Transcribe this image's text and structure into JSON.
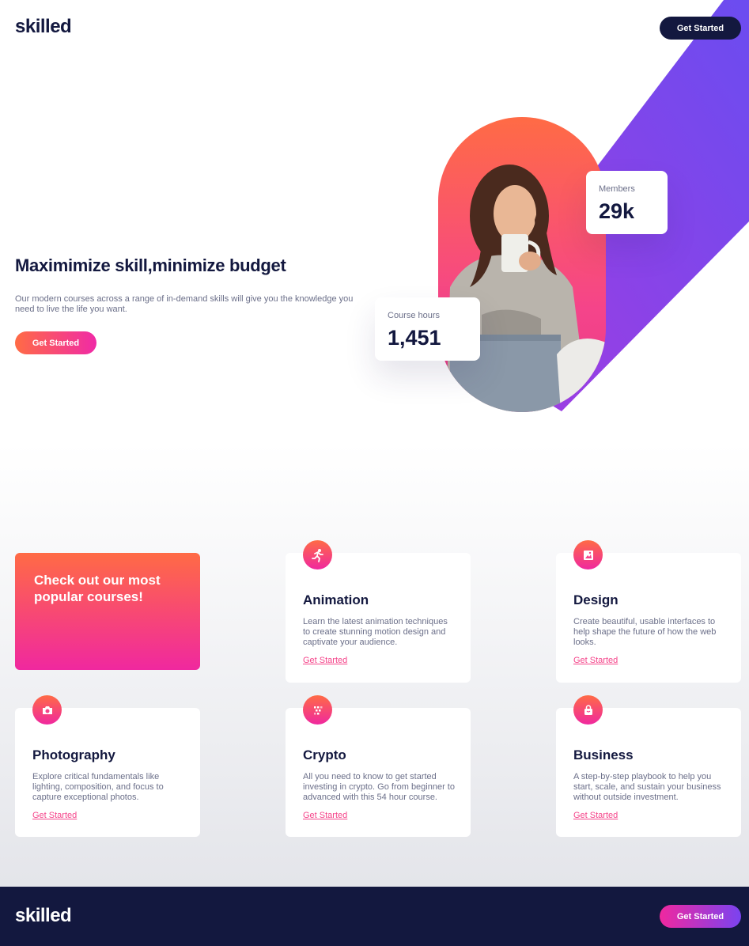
{
  "header": {
    "logo": "skilled",
    "cta_label": "Get Started"
  },
  "hero": {
    "title": "Maximimize skill,minimize budget",
    "description": "Our modern courses across a range of in-demand skills will give you the knowledge you need to live the life you want.",
    "cta_label": "Get Started",
    "stats": {
      "members_label": "Members",
      "members_value": "29k",
      "hours_label": "Course hours",
      "hours_value": "1,451"
    }
  },
  "courses": {
    "promo_text": "Check out our most popular courses!",
    "items": [
      {
        "title": "Animation",
        "description": "Learn the latest animation techniques to create stunning motion design and captivate your audience.",
        "link": "Get Started",
        "icon": "running-figure-icon"
      },
      {
        "title": "Design",
        "description": "Create beautiful, usable interfaces to help shape the future of how the web looks.",
        "link": "Get Started",
        "icon": "image-frame-icon"
      },
      {
        "title": "Photography",
        "description": "Explore critical fundamentals like lighting, composition, and focus to capture exceptional photos.",
        "link": "Get Started",
        "icon": "camera-icon"
      },
      {
        "title": "Crypto",
        "description": "All you need to know to get started investing in crypto. Go from beginner to advanced with this 54 hour course.",
        "link": "Get Started",
        "icon": "crypto-grid-icon"
      },
      {
        "title": "Business",
        "description": "A step-by-step playbook to help you start, scale, and sustain your business without outside investment.",
        "link": "Get Started",
        "icon": "shopping-bag-icon"
      }
    ]
  },
  "footer": {
    "logo": "skilled",
    "cta_label": "Get Started"
  },
  "colors": {
    "navy": "#13183f",
    "accent_orange": "#ff6b45",
    "accent_pink": "#f0289f",
    "accent_purple": "#6b4cf0",
    "text_muted": "#6b6f89"
  }
}
